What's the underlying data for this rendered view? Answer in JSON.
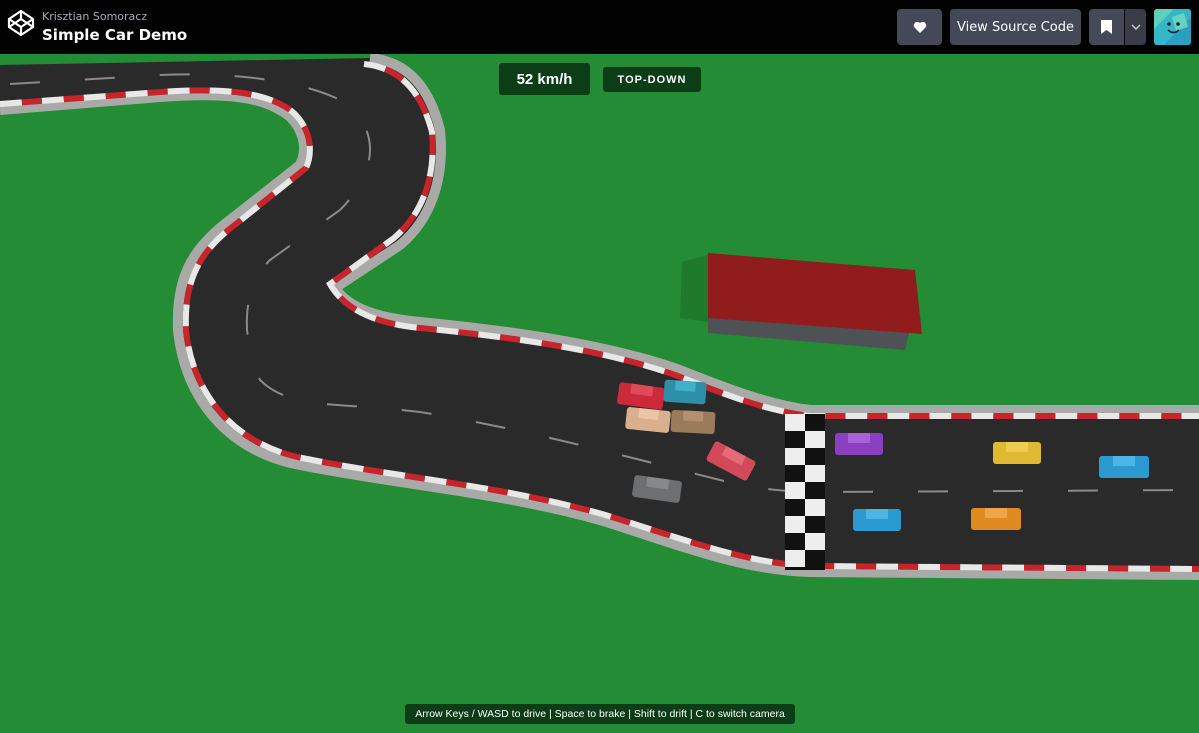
{
  "header": {
    "author": "Krisztian Somoracz",
    "title": "Simple Car Demo",
    "view_source_label": "View Source Code",
    "icons": [
      "codepen-logo-icon",
      "heart-icon",
      "bookmark-icon",
      "chevron-down-icon",
      "avatar"
    ]
  },
  "hud": {
    "speed": "52 km/h",
    "camera_mode": "TOP-DOWN",
    "controls_help": "Arrow Keys / WASD to drive  |  Space to brake  |  Shift to drift  |  C to switch camera"
  },
  "colors": {
    "grass": "#238c35",
    "asphalt": "#2a2a2a",
    "curb_red": "#c8242c",
    "curb_white": "#e8e8e8",
    "barrier": "#a9aaa7",
    "hud_bg": "#0d3d16",
    "header_bg": "#010101",
    "button_bg": "#444857",
    "building_roof": "#901c1c"
  },
  "scene": {
    "cars": [
      {
        "color": "#cc2a3a"
      },
      {
        "color": "#2e8fa8"
      },
      {
        "color": "#d8b08e"
      },
      {
        "color": "#9a7b5c"
      },
      {
        "color": "#d24a5a"
      },
      {
        "color": "#6d6f70"
      },
      {
        "color": "#8a3fc0"
      },
      {
        "color": "#e0b832"
      },
      {
        "color": "#2a9ad0"
      },
      {
        "color": "#2a9ad0"
      },
      {
        "color": "#e08a22"
      }
    ]
  }
}
